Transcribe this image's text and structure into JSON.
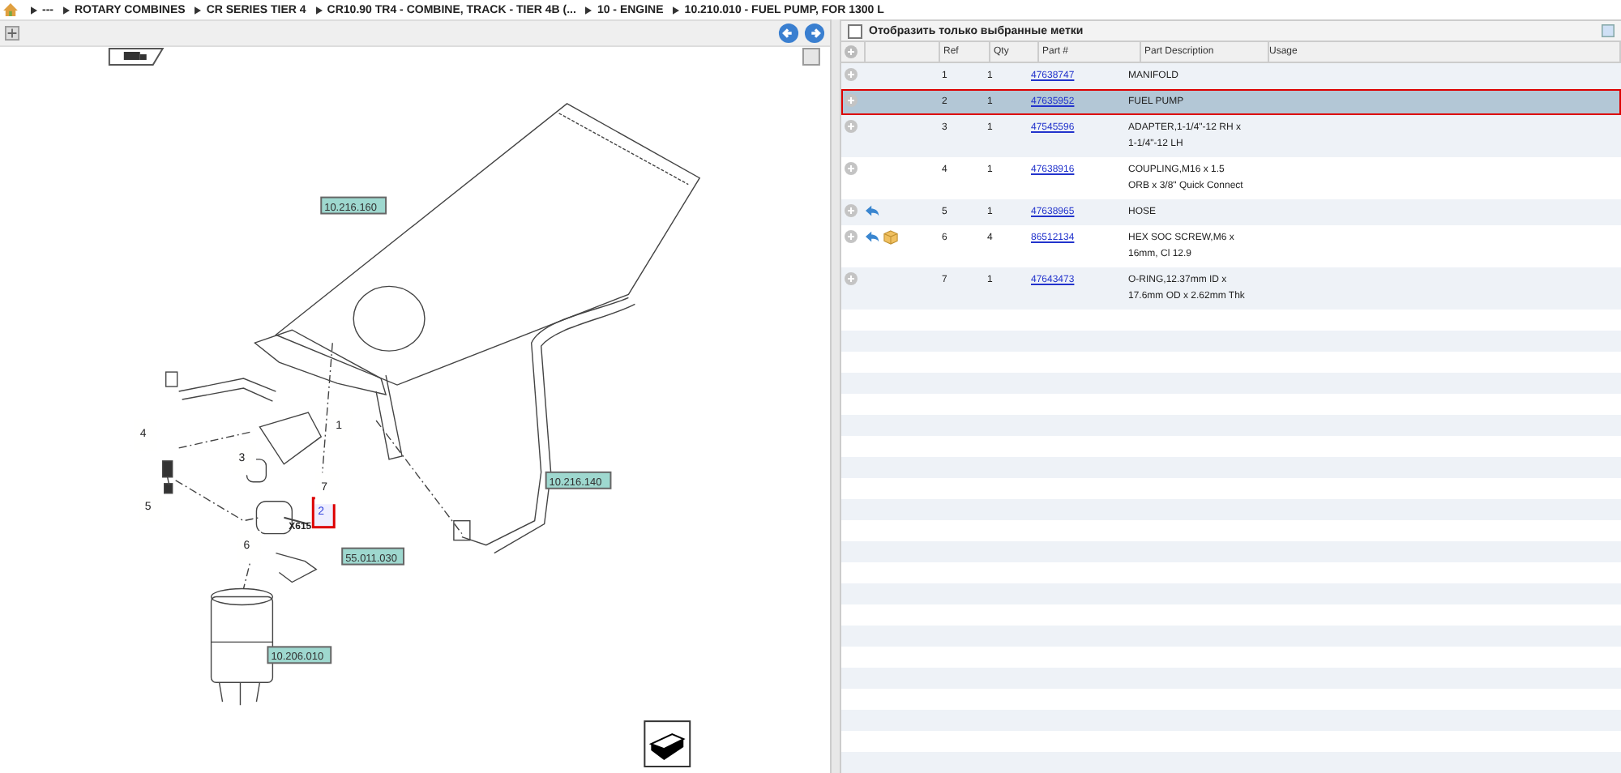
{
  "breadcrumb": [
    "---",
    "ROTARY COMBINES",
    "CR SERIES TIER 4",
    "CR10.90 TR4 - COMBINE, TRACK - TIER 4B (...",
    "10 - ENGINE",
    "10.210.010 - FUEL PUMP, FOR 1300 L"
  ],
  "diagram": {
    "callouts": [
      {
        "label": "10.216.160",
        "kind": "section"
      },
      {
        "label": "10.216.140",
        "kind": "section"
      },
      {
        "label": "55.011.030",
        "kind": "section"
      },
      {
        "label": "10.206.010",
        "kind": "section"
      },
      {
        "label": "1",
        "kind": "ref",
        "selected": false
      },
      {
        "label": "2",
        "kind": "ref",
        "selected": true
      },
      {
        "label": "3",
        "kind": "ref",
        "selected": false
      },
      {
        "label": "4",
        "kind": "ref",
        "selected": false
      },
      {
        "label": "5",
        "kind": "ref",
        "selected": false
      },
      {
        "label": "6",
        "kind": "ref",
        "selected": false
      },
      {
        "label": "7",
        "kind": "ref",
        "selected": false
      },
      {
        "label": "X615",
        "kind": "connector"
      }
    ]
  },
  "filter": {
    "label": "Отобразить только выбранные метки",
    "checked": false
  },
  "table": {
    "columns": [
      "Ref",
      "Qty",
      "Part #",
      "Part Description",
      "Usage"
    ],
    "rows": [
      {
        "ref": "1",
        "qty": "1",
        "part": "47638747",
        "description": "MANIFOLD",
        "selected": false,
        "substitute": false,
        "kit": false
      },
      {
        "ref": "2",
        "qty": "1",
        "part": "47635952",
        "description": "FUEL PUMP",
        "selected": true,
        "substitute": false,
        "kit": false
      },
      {
        "ref": "3",
        "qty": "1",
        "part": "47545596",
        "description": "ADAPTER,1-1/4\"-12 RH x 1-1/4\"-12 LH",
        "selected": false,
        "substitute": false,
        "kit": false
      },
      {
        "ref": "4",
        "qty": "1",
        "part": "47638916",
        "description": "COUPLING,M16 x 1.5 ORB x 3/8\" Quick Connect",
        "selected": false,
        "substitute": false,
        "kit": false
      },
      {
        "ref": "5",
        "qty": "1",
        "part": "47638965",
        "description": "HOSE",
        "selected": false,
        "substitute": true,
        "kit": false
      },
      {
        "ref": "6",
        "qty": "4",
        "part": "86512134",
        "description": "HEX SOC SCREW,M6 x 16mm, Cl 12.9",
        "selected": false,
        "substitute": true,
        "kit": true
      },
      {
        "ref": "7",
        "qty": "1",
        "part": "47643473",
        "description": "O-RING,12.37mm ID x 17.6mm OD x 2.62mm Thk",
        "selected": false,
        "substitute": false,
        "kit": false
      }
    ]
  }
}
